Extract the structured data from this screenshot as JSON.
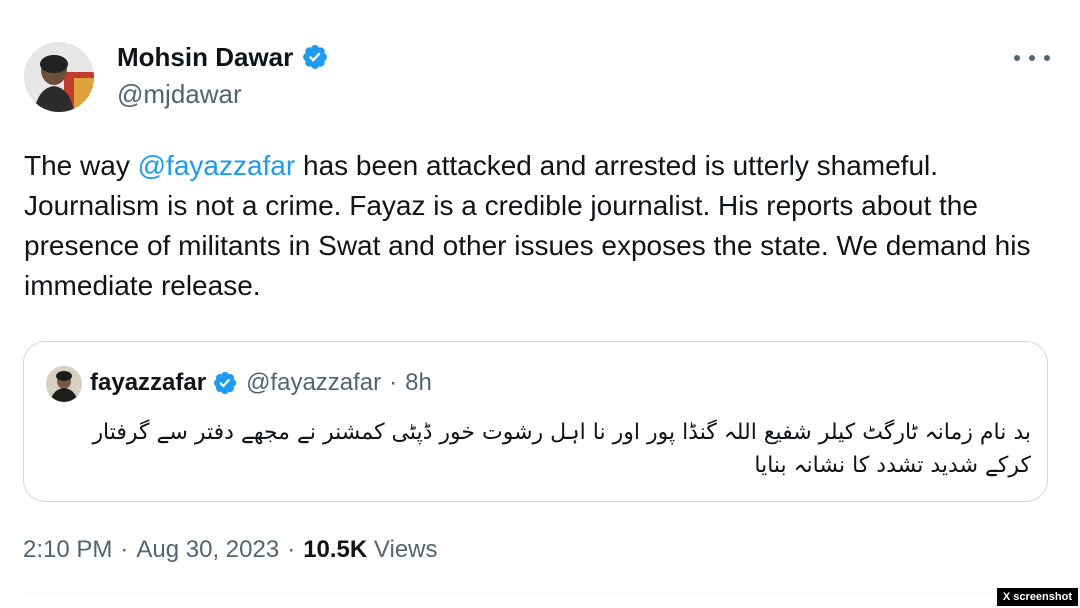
{
  "author": {
    "name": "Mohsin Dawar",
    "handle": "@mjdawar"
  },
  "tweet": {
    "text_before_mention": "The way ",
    "mention": "@fayazzafar",
    "text_after_mention": " has been attacked and arrested is utterly shameful. Journalism is not a crime. Fayaz is a credible journalist. His reports about the presence of militants in Swat and other issues exposes the state. We demand his immediate release."
  },
  "quote": {
    "name": "fayazzafar",
    "handle": "@fayazzafar",
    "separator": "·",
    "time": "8h",
    "text": "بد نام زمانہ ٹارگٹ کیلر شفیع اللہ گنڈا پور اور نا اہل رشوت خور ڈپٹی کمشنر نے مجھے دفتر سے گرفتار کرکے شدید تشدد کا نشانہ بنایا"
  },
  "meta": {
    "time": "2:10 PM",
    "separator": "·",
    "date": "Aug 30, 2023",
    "views_count": "10.5K",
    "views_label": "Views"
  },
  "watermark": "X screenshot",
  "colors": {
    "accent": "#1d9bf0",
    "secondary_text": "#536471",
    "border": "#cfd9de"
  },
  "icons": {
    "verified": "verified-badge-icon",
    "more": "more-options-icon"
  }
}
